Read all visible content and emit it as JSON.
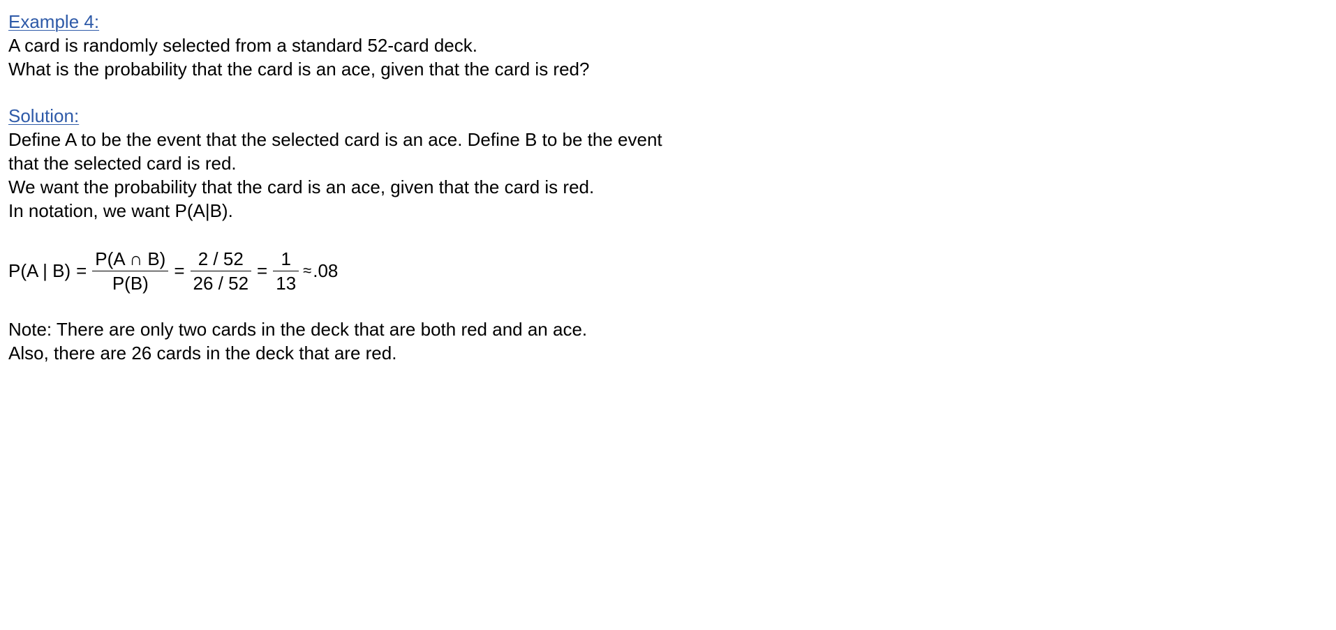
{
  "example": {
    "heading": "Example 4:",
    "lines": [
      "A card is randomly selected from a standard 52-card deck.",
      "What is the probability that the card is an ace, given that the card is red?"
    ]
  },
  "solution": {
    "heading": "Solution:",
    "lines": [
      "Define A to be the event that the selected card is an ace.  Define B to be the event",
      "that the selected card is red.",
      "We want the probability that the card is an ace, given that the card is red.",
      "In notation, we want P(A|B)."
    ]
  },
  "equation": {
    "lhs": "P(A | B)",
    "eq1": "=",
    "frac1_num": "P(A ∩ B)",
    "frac1_den": "P(B)",
    "eq2": "=",
    "frac2_num": "2 / 52",
    "frac2_den": "26 / 52",
    "eq3": "=",
    "frac3_num": "1",
    "frac3_den": "13",
    "approx_symbol": "≈",
    "result": ".08"
  },
  "note": {
    "lines": [
      "Note:  There are only two cards in the deck that are both red and an ace.",
      "Also, there are 26 cards in the deck that are red."
    ]
  },
  "colors": {
    "heading": "#2e5aa8",
    "text": "#000000",
    "background": "#ffffff"
  }
}
